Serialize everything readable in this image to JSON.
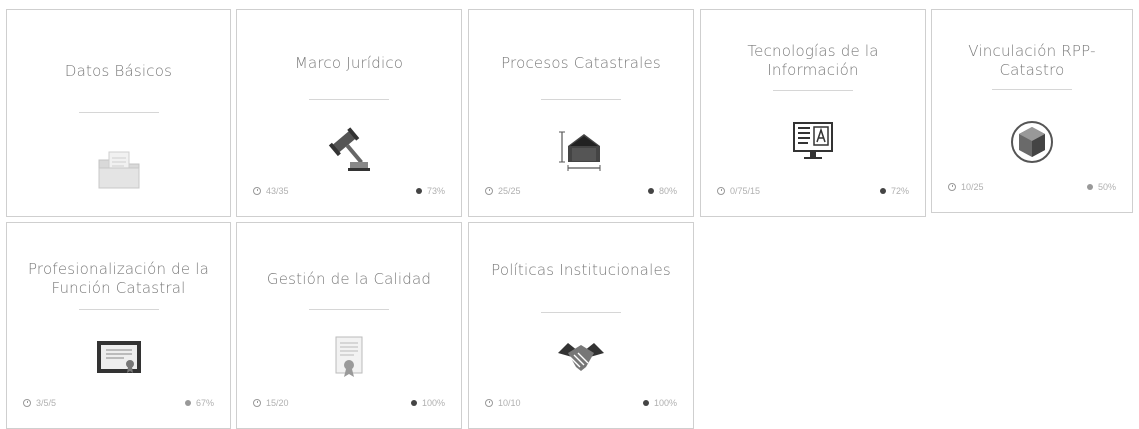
{
  "cards": [
    {
      "title": "Datos Básicos",
      "progress_left": "",
      "progress_right": ""
    },
    {
      "title": "Marco Jurídico",
      "progress_left": "43/35",
      "progress_right": "73%"
    },
    {
      "title": "Procesos Catastrales",
      "progress_left": "25/25",
      "progress_right": "80%"
    },
    {
      "title": "Tecnologías de la Información",
      "progress_left": "0/75/15",
      "progress_right": "72%"
    },
    {
      "title": "Vinculación RPP-Catastro",
      "progress_left": "10/25",
      "progress_right": "50%"
    },
    {
      "title": "Profesionalización de la Función Catastral",
      "progress_left": "3/5/5",
      "progress_right": "67%"
    },
    {
      "title": "Gestión de la Calidad",
      "progress_left": "15/20",
      "progress_right": "100%"
    },
    {
      "title": "Políticas Institucionales",
      "progress_left": "10/10",
      "progress_right": "100%"
    }
  ],
  "icons": [
    "folder-icon",
    "gavel-icon",
    "house-measure-icon",
    "computer-screen-icon",
    "cube-target-icon",
    "certificate-icon",
    "document-seal-icon",
    "handshake-icon"
  ]
}
